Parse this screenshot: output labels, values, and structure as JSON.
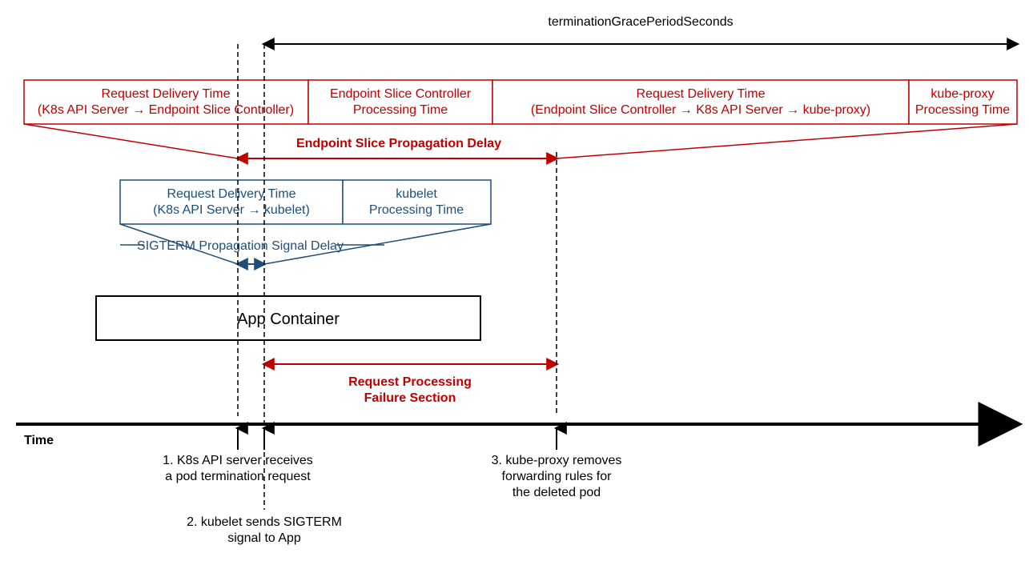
{
  "grace_label": "terminationGracePeriodSeconds",
  "red_segments": {
    "A": {
      "line1": "Request Delivery Time",
      "line2": "(K8s API Server → Endpoint Slice Controller)"
    },
    "B": {
      "line1": "Endpoint Slice Controller",
      "line2": "Processing Time"
    },
    "C": {
      "line1": "Request Delivery Time",
      "line2": "(Endpoint Slice Controller → K8s API Server → kube-proxy)"
    },
    "D": {
      "line1": "kube-proxy",
      "line2": "Processing Time"
    }
  },
  "red_delay_label": "Endpoint Slice Propagation Delay",
  "blue_segments": {
    "A": {
      "line1": "Request Delivery Time",
      "line2": "(K8s API Server → kubelet)"
    },
    "B": {
      "line1": "kubelet",
      "line2": "Processing Time"
    }
  },
  "blue_delay_label": "SIGTERM Propagation Signal Delay",
  "app_container_label": "App Container",
  "failure_label": {
    "line1": "Request Processing",
    "line2": "Failure Section"
  },
  "time_axis_label": "Time",
  "events": {
    "e1": {
      "line1": "1. K8s API server receives",
      "line2": "a pod termination request"
    },
    "e2": {
      "line1": "2. kubelet sends SIGTERM",
      "line2": "signal to App"
    },
    "e3": {
      "line1": "3. kube-proxy removes",
      "line2": "forwarding rules for",
      "line3": "the deleted pod"
    }
  }
}
